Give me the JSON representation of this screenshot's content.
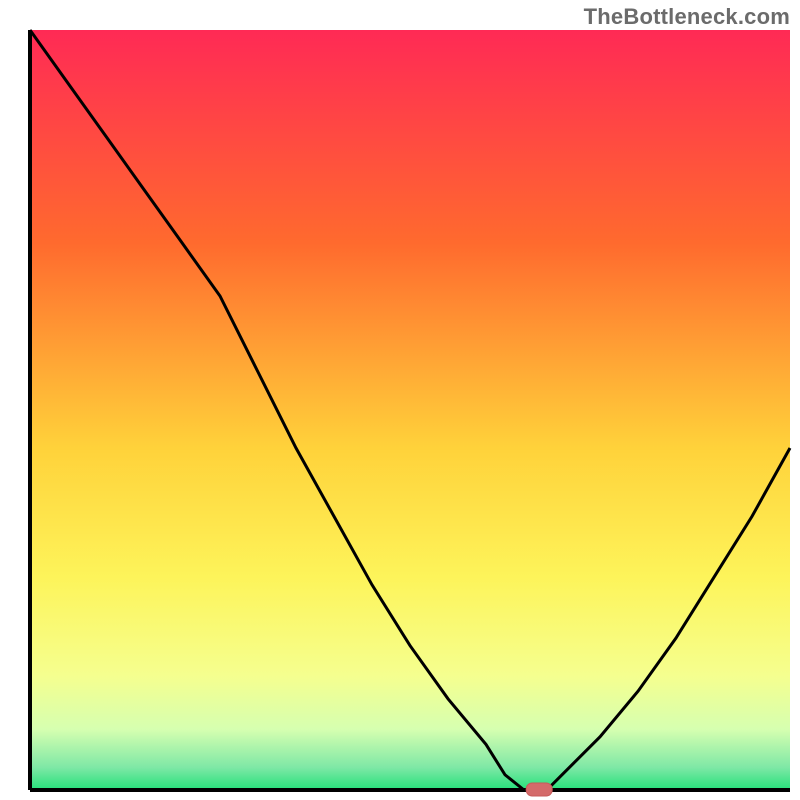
{
  "watermark": "TheBottleneck.com",
  "colors": {
    "gradient_top": "#ff2a55",
    "gradient_mid1": "#ff6a2e",
    "gradient_mid2": "#ffd23a",
    "gradient_mid3": "#fdf45a",
    "gradient_mid4": "#f5ff8f",
    "gradient_bottom_band_light": "#d6ffb0",
    "gradient_bottom_band_green": "#25e07a",
    "axis": "#000000",
    "curve": "#000000",
    "marker_fill": "#d46a6a",
    "marker_stroke": "#c75a5a"
  },
  "chart_data": {
    "type": "line",
    "title": "",
    "xlabel": "",
    "ylabel": "",
    "xlim": [
      0,
      100
    ],
    "ylim": [
      0,
      100
    ],
    "x": [
      0,
      5,
      10,
      15,
      20,
      25,
      30,
      35,
      40,
      45,
      50,
      55,
      60,
      62.5,
      65,
      67,
      68,
      70,
      75,
      80,
      85,
      90,
      95,
      100
    ],
    "y": [
      100,
      93,
      86,
      79,
      72,
      65,
      55,
      45,
      36,
      27,
      19,
      12,
      6,
      2,
      0,
      0,
      0,
      2,
      7,
      13,
      20,
      28,
      36,
      45
    ],
    "optimal_marker": {
      "x": 67,
      "y": 0
    },
    "grid": false,
    "legend": false
  }
}
